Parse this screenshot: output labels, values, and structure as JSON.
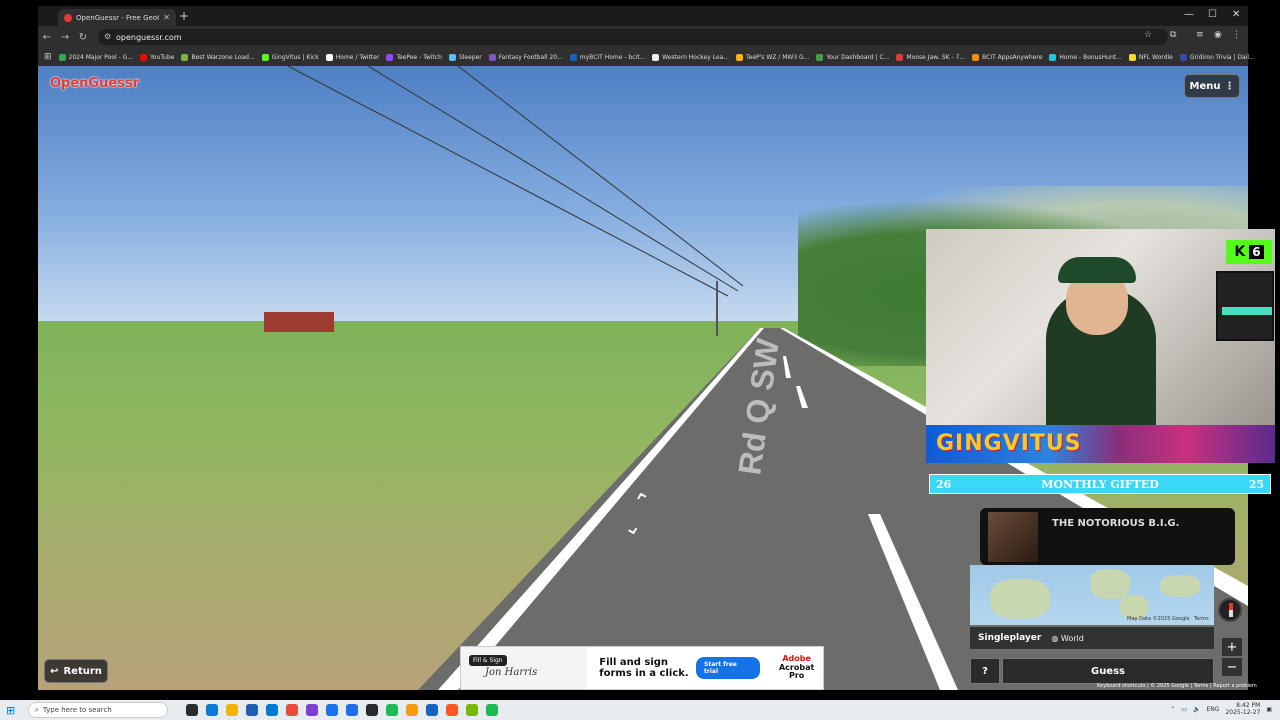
{
  "browser": {
    "tab_title": "OpenGuessr - Free GeoGuessr...",
    "url": "openguessr.com",
    "bookmarks": [
      {
        "label": "2024 Major Pool - G...",
        "color": "#34a853"
      },
      {
        "label": "YouTube",
        "color": "#ff0000"
      },
      {
        "label": "Best Warzone Load...",
        "color": "#7cb342"
      },
      {
        "label": "GingVitus | Kick",
        "color": "#53fc18"
      },
      {
        "label": "Home / Twitter",
        "color": "#ffffff"
      },
      {
        "label": "TeePee - Twitch",
        "color": "#9146ff"
      },
      {
        "label": "Sleeper",
        "color": "#4fc3f7"
      },
      {
        "label": "Fantasy Football 20...",
        "color": "#7e57c2"
      },
      {
        "label": "myBCIT Home - bcit...",
        "color": "#1565c0"
      },
      {
        "label": "Western Hockey Lea...",
        "color": "#eeeeee"
      },
      {
        "label": "TeeP's WZ / MW3 G...",
        "color": "#ffb300"
      },
      {
        "label": "Your Dashboard | C...",
        "color": "#43a047"
      },
      {
        "label": "Moose Jaw, SK - 7...",
        "color": "#e53935"
      },
      {
        "label": "BCIT AppsAnywhere",
        "color": "#fb8c00"
      },
      {
        "label": "Home - BonusHunt...",
        "color": "#26c6da"
      },
      {
        "label": "NFL Wordle",
        "color": "#fdd835"
      },
      {
        "label": "Gridiron Trivia | Dail...",
        "color": "#3949ab"
      }
    ]
  },
  "game": {
    "logo": "OpenGuessr",
    "menu_label": "Menu",
    "return_label": "Return",
    "road_sign": "Rd Q SW",
    "mode_label": "Singleplayer",
    "world_label": "World",
    "help_label": "?",
    "guess_label": "Guess",
    "map_attribution": "Map Data ©2025 Google",
    "map_terms": "Terms",
    "footer": "Keyboard shortcuts  |  © 2025 Google  |  Terms  |  Report a problem"
  },
  "ad": {
    "sig_button": "Fill & Sign",
    "signature": "Jon Harris",
    "headline": "Fill and sign forms in a click.",
    "cta": "Start free trial",
    "brand_top": "Adobe",
    "brand_bottom": "Acrobat Pro"
  },
  "stream": {
    "kick_count": "6",
    "banner_text": "GINGVITUS",
    "gifted_left": "26",
    "gifted_label": "MONTHLY GIFTED",
    "gifted_right": "25",
    "now_playing": "THE NOTORIOUS B.I.G."
  },
  "taskbar": {
    "search_placeholder": "Type here to search",
    "lang": "ENG",
    "time": "8:42 PM",
    "date": "2025-12-27"
  }
}
